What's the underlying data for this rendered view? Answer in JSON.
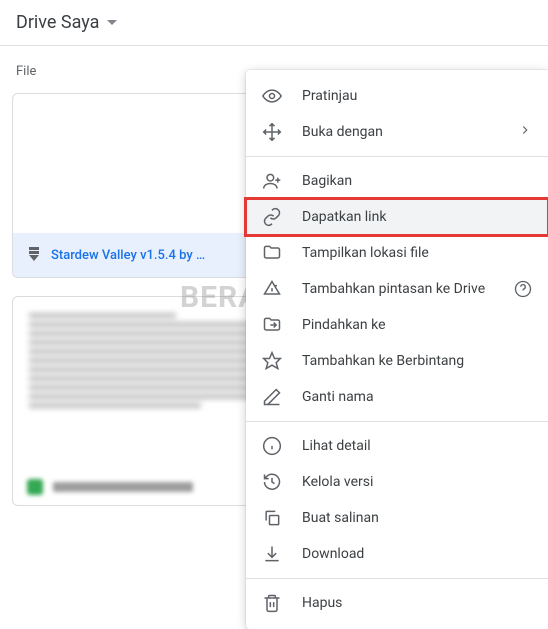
{
  "header": {
    "title": "Drive Saya"
  },
  "section": {
    "label": "File"
  },
  "file": {
    "name": "Stardew Valley v1.5.4 by …"
  },
  "watermark": "BERAKAL",
  "menu": {
    "preview": "Pratinjau",
    "open_with": "Buka dengan",
    "share": "Bagikan",
    "get_link": "Dapatkan link",
    "show_location": "Tampilkan lokasi file",
    "add_shortcut": "Tambahkan pintasan ke Drive",
    "move_to": "Pindahkan ke",
    "add_starred": "Tambahkan ke Berbintang",
    "rename": "Ganti nama",
    "view_details": "Lihat detail",
    "manage_versions": "Kelola versi",
    "make_copy": "Buat salinan",
    "download": "Download",
    "remove": "Hapus"
  }
}
